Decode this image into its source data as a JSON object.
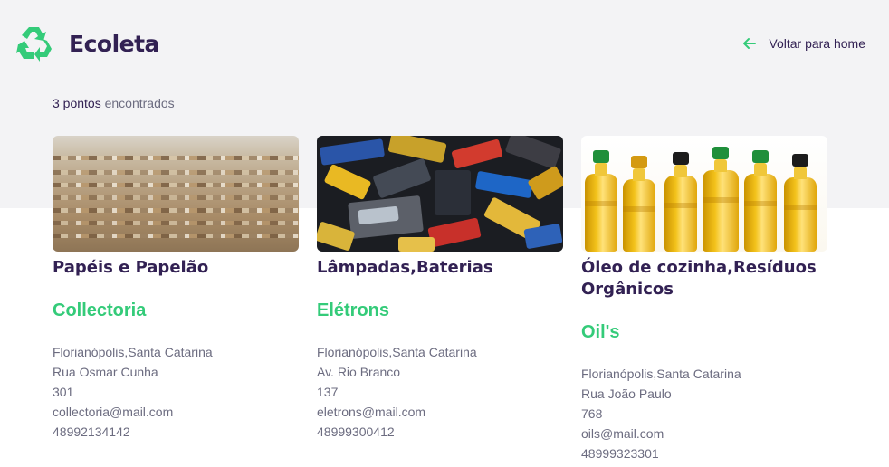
{
  "header": {
    "brand_name": "Ecoleta",
    "logo_icon": "recycle-icon",
    "back_label": "Voltar para home",
    "back_icon": "arrow-left-icon"
  },
  "results": {
    "count": "3 pontos",
    "suffix": "encontrados"
  },
  "points": [
    {
      "items": "Papéis e Papelão",
      "name": "Collectoria",
      "city_uf": "Florianópolis,Santa Catarina",
      "street": "Rua Osmar Cunha",
      "number": "301",
      "email": "collectoria@mail.com",
      "whatsapp": "48992134142",
      "image": "cardboard-bales-photo"
    },
    {
      "items": "Lâmpadas,Baterias",
      "name": "Elétrons",
      "city_uf": "Florianópolis,Santa Catarina",
      "street": "Av. Rio Branco",
      "number": "137",
      "email": "eletrons@mail.com",
      "whatsapp": "48999300412",
      "image": "batteries-pile-photo"
    },
    {
      "items": "Óleo de cozinha,Resíduos Orgânicos",
      "name": "Oil's",
      "city_uf": "Florianópolis,Santa Catarina",
      "street": "Rua João Paulo",
      "number": "768",
      "email": "oils@mail.com",
      "whatsapp": "48999323301",
      "image": "oil-bottles-photo"
    }
  ],
  "colors": {
    "brand_dark": "#322153",
    "accent_green": "#34cb79",
    "text_muted": "#6c6c80",
    "band_bg": "#f3f3f5"
  }
}
